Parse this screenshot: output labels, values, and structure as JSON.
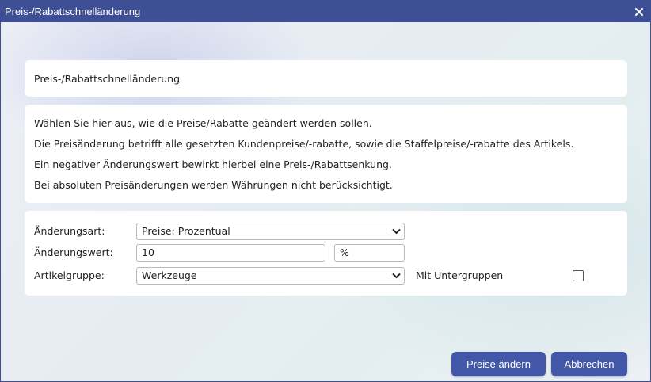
{
  "window": {
    "title": "Preis-/Rabattschnelländerung",
    "close_symbol": "✕"
  },
  "header": {
    "text": "Preis-/Rabattschnelländerung"
  },
  "info": {
    "lines": [
      "Wählen Sie hier aus, wie die Preise/Rabatte geändert werden sollen.",
      "Die Preisänderung betrifft alle gesetzten Kundenpreise/-rabatte, sowie die Staffelpreise/-rabatte des Artikels.",
      "Ein negativer Änderungswert bewirkt hierbei eine Preis-/Rabattsenkung.",
      "Bei absoluten Preisänderungen werden Währungen nicht berücksichtigt."
    ]
  },
  "form": {
    "change_type": {
      "label": "Änderungsart:",
      "value": "Preise: Prozentual"
    },
    "change_value": {
      "label": "Änderungswert:",
      "value": "10",
      "unit": "%"
    },
    "article_group": {
      "label": "Artikelgruppe:",
      "value": "Werkzeuge"
    },
    "subgroups": {
      "label": "Mit Untergruppen",
      "checked": false
    }
  },
  "buttons": {
    "apply": "Preise ändern",
    "cancel": "Abbrechen"
  },
  "colors": {
    "titlebar": "#3f4f95",
    "button": "#4257a8"
  }
}
